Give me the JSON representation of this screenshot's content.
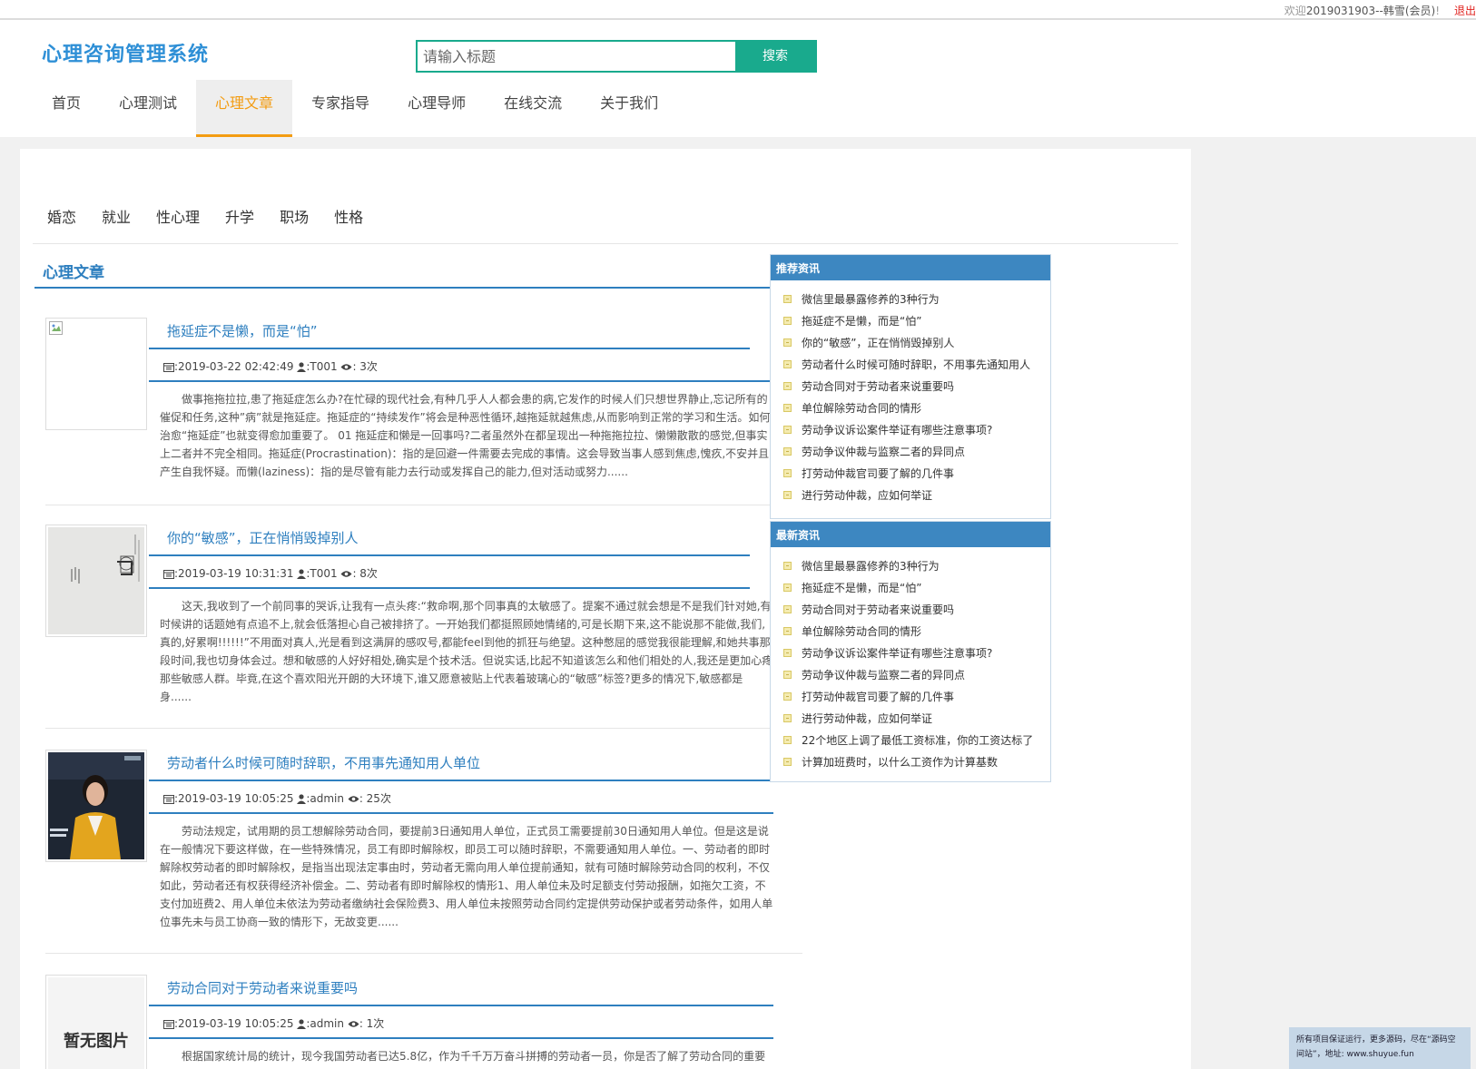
{
  "topbar": {
    "welcome_prefix": "欢迎",
    "user": "2019031903--韩雪(会员)",
    "suffix": "!",
    "logout": "退出"
  },
  "header": {
    "logo": "心理咨询管理系统",
    "search_placeholder": "请输入标题",
    "search_button": "搜索"
  },
  "nav": [
    {
      "label": "首页"
    },
    {
      "label": "心理测试"
    },
    {
      "label": "心理文章"
    },
    {
      "label": "专家指导"
    },
    {
      "label": "心理导师"
    },
    {
      "label": "在线交流"
    },
    {
      "label": "关于我们"
    }
  ],
  "categories": [
    "婚恋",
    "就业",
    "性心理",
    "升学",
    "职场",
    "性格"
  ],
  "section_title": "心理文章",
  "articles": [
    {
      "title": "拖延症不是懒，而是“怕”",
      "date": ":2019-03-22 02:42:49",
      "author": ":T001",
      "views": ": 3次",
      "summary": "做事拖拖拉拉,患了拖延症怎么办?在忙碌的现代社会,有种几乎人人都会患的病,它发作的时候人们只想世界静止,忘记所有的催促和任务,这种”病”就是拖延症。拖延症的“持续发作”将会是种恶性循环,越拖延就越焦虑,从而影响到正常的学习和生活。如何治愈“拖延症”也就变得愈加重要了。 01 拖延症和懒是一回事吗?二者虽然外在都呈现出一种拖拖拉拉、懒懒散散的感觉,但事实上二者并不完全相同。拖延症(Procrastination)：指的是回避一件需要去完成的事情。这会导致当事人感到焦虑,愧疚,不安并且产生自我怀疑。而懒(laziness)：指的是尽管有能力去行动或发挥自己的能力,但对活动或努力......",
      "thumb": "broken"
    },
    {
      "title": "你的“敏感”，正在悄悄毁掉别人",
      "date": ":2019-03-19 10:31:31",
      "author": ":T001",
      "views": ": 8次",
      "summary": "这天,我收到了一个前同事的哭诉,让我有一点头疼:“救命啊,那个同事真的太敏感了。提案不通过就会想是不是我们针对她,有时候讲的话题她有点追不上,就会低落担心自己被排挤了。一开始我们都挺照顾她情绪的,可是长期下来,这不能说那不能做,我们,真的,好累啊!!!!!!”不用面对真人,光是看到这满屏的感叹号,都能feel到他的抓狂与绝望。这种憋屈的感觉我很能理解,和她共事那段时间,我也切身体会过。想和敏感的人好好相处,确实是个技术活。但说实话,比起不知道该怎么和他们相处的人,我还是更加心疼那些敏感人群。毕竟,在这个喜欢阳光开朗的大环境下,谁又愿意被贴上代表着玻璃心的“敏感”标签?更多的情况下,敏感都是身......",
      "thumb": "sketch"
    },
    {
      "title": "劳动者什么时候可随时辞职，不用事先通知用人单位",
      "date": ":2019-03-19 10:05:25",
      "author": ":admin",
      "views": ": 25次",
      "summary": "劳动法规定，试用期的员工想解除劳动合同，要提前3日通知用人单位，正式员工需要提前30日通知用人单位。但是这是说在一般情况下要这样做，在一些特殊情况，员工有即时解除权，即员工可以随时辞职，不需要通知用人单位。一、劳动者的即时解除权劳动者的即时解除权，是指当出现法定事由时，劳动者无需向用人单位提前通知，就有可随时解除劳动合同的权利，不仅如此，劳动者还有权获得经济补偿金。二、劳动者有即时解除权的情形1、用人单位未及时足额支付劳动报酬，如拖欠工资，不支付加班费2、用人单位未依法为劳动者缴纳社会保险费3、用人单位未按照劳动合同约定提供劳动保护或者劳动条件，如用人单位事先未与员工协商一致的情形下，无故变更......",
      "thumb": "anchor"
    },
    {
      "title": "劳动合同对于劳动者来说重要吗",
      "date": ":2019-03-19 10:05:25",
      "author": ":admin",
      "views": ": 1次",
      "summary": "根据国家统计局的统计，现今我国劳动者已达5.8亿，作为千千万万奋斗拼搏的劳动者一员，你是否了解了劳动合同的重要",
      "thumb": "noimage",
      "thumb_text": "暂无图片"
    }
  ],
  "recommend": {
    "title": "推荐资讯",
    "items": [
      "微信里最暴露修养的3种行为",
      "拖延症不是懒，而是“怕”",
      "你的“敏感”，正在悄悄毁掉别人",
      "劳动者什么时候可随时辞职，不用事先通知用人",
      "劳动合同对于劳动者来说重要吗",
      "单位解除劳动合同的情形",
      "劳动争议诉讼案件举证有哪些注意事项?",
      "劳动争议仲裁与监察二者的异同点",
      "打劳动仲裁官司要了解的几件事",
      "进行劳动仲裁，应如何举证"
    ]
  },
  "latest": {
    "title": "最新资讯",
    "items": [
      "微信里最暴露修养的3种行为",
      "拖延症不是懒，而是“怕”",
      "劳动合同对于劳动者来说重要吗",
      "单位解除劳动合同的情形",
      "劳动争议诉讼案件举证有哪些注意事项?",
      "劳动争议仲裁与监察二者的异同点",
      "打劳动仲裁官司要了解的几件事",
      "进行劳动仲裁，应如何举证",
      "22个地区上调了最低工资标准，你的工资达标了",
      "计算加班费时，以什么工资作为计算基数"
    ]
  },
  "footer_note": {
    "line1": "所有项目保证运行，更多源码，尽在“源码空间站”，地址: www.shuyue.fun"
  },
  "colors": {
    "brand_blue": "#2e8fd6",
    "accent_green": "#19aa8d",
    "nav_active": "#f39c12",
    "panel_head": "#3d87c1"
  }
}
